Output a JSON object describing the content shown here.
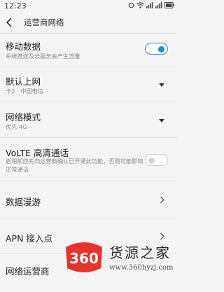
{
  "status_bar": {
    "time": "12:23",
    "icons": [
      "notification-dot-icon",
      "wifi-icon",
      "signal-icon",
      "signal-icon",
      "battery-icon"
    ]
  },
  "header": {
    "title": "运营商网络"
  },
  "settings": {
    "mobile_data": {
      "title": "移动数据",
      "subtitle": "系统推送及云服务会产生流量",
      "enabled": true
    },
    "default_network": {
      "title": "默认上网",
      "subtitle": "卡2 · 中国电信"
    },
    "network_mode": {
      "title": "网络模式",
      "subtitle": "优先 4G"
    },
    "volte": {
      "title": "VoLTE 高清通话",
      "subtitle": "启用前应先向运营商确认已开通此功能，否则可能影响正常通话",
      "enabled": false
    },
    "data_roaming": {
      "title": "数据漫游"
    },
    "apn": {
      "title": "APN 接入点"
    },
    "network_operator": {
      "title": "网络运营商"
    }
  },
  "watermark": {
    "logo": "360",
    "name": "货源之家",
    "url": "www.360hyzj.com"
  },
  "colors": {
    "accent": "#2a8ad4",
    "background": "#f4f4f4",
    "watermark_red": "#e8332a"
  }
}
